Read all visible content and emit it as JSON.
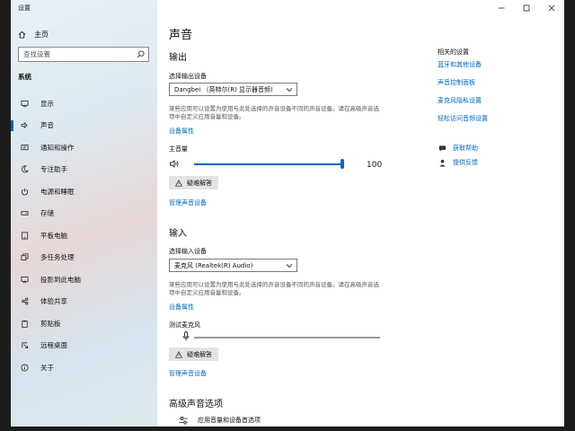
{
  "window": {
    "title": "设置"
  },
  "sidebar": {
    "home_label": "主页",
    "search_placeholder": "查找设置",
    "section_title": "系统",
    "items": [
      {
        "label": "显示",
        "icon": "display-icon"
      },
      {
        "label": "声音",
        "icon": "speaker-icon"
      },
      {
        "label": "通知和操作",
        "icon": "notification-icon"
      },
      {
        "label": "专注助手",
        "icon": "moon-icon"
      },
      {
        "label": "电源和睡眠",
        "icon": "power-icon"
      },
      {
        "label": "存储",
        "icon": "storage-icon"
      },
      {
        "label": "平板电脑",
        "icon": "tablet-icon"
      },
      {
        "label": "多任务处理",
        "icon": "multitask-icon"
      },
      {
        "label": "投影到此电脑",
        "icon": "project-icon"
      },
      {
        "label": "体验共享",
        "icon": "share-icon"
      },
      {
        "label": "剪贴板",
        "icon": "clipboard-icon"
      },
      {
        "label": "远程桌面",
        "icon": "remote-icon"
      },
      {
        "label": "关于",
        "icon": "info-icon"
      }
    ],
    "selected": "声音"
  },
  "main": {
    "title": "声音",
    "output": {
      "heading": "输出",
      "device_label": "选择输出设备",
      "device_value": "Dangbei （英特尔(R) 显示器音频)",
      "description": "某些应用可以设置为使用与此处选择的声音设备不同的声音设备。请在高级声音选项中自定义应用音量和设备。",
      "properties_link": "设备属性",
      "volume_label": "主音量",
      "volume_value": "100",
      "volume_level": 100,
      "troubleshoot_label": "疑难解答",
      "manage_link": "管理声音设备"
    },
    "input": {
      "heading": "输入",
      "device_label": "选择输入设备",
      "device_value": "麦克风 (Realtek(R) Audio)",
      "description": "某些应用可以设置为使用与此处选择的声音设备不同的声音设备。请在高级声音选项中自定义应用音量和设备。",
      "properties_link": "设备属性",
      "test_label": "测试麦克风",
      "mic_level": 0,
      "troubleshoot_label": "疑难解答",
      "manage_link": "管理声音设备"
    },
    "advanced": {
      "heading": "高级声音选项",
      "app_volume_label": "应用音量和设备首选项"
    }
  },
  "related": {
    "title": "相关的设置",
    "links": [
      "蓝牙和其他设备",
      "声音控制面板",
      "麦克风隐私设置",
      "轻松访问音频设置"
    ],
    "help_label": "获取帮助",
    "feedback_label": "提供反馈"
  },
  "colors": {
    "accent": "#0067c0"
  }
}
